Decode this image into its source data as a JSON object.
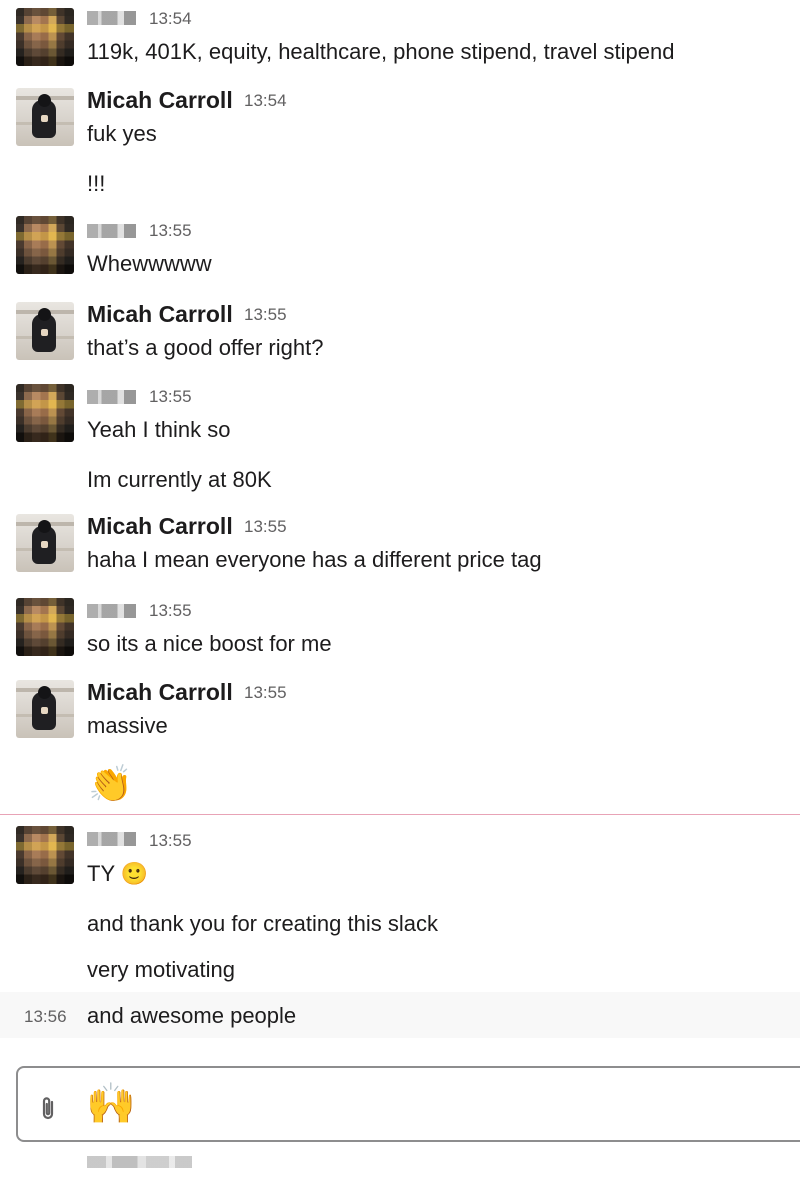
{
  "messages": [
    {
      "author": "",
      "time": "13:54",
      "lines": [
        "119k, 401K, equity, healthcare, phone stipend, travel stipend"
      ]
    },
    {
      "author": "Micah Carroll",
      "time": "13:54",
      "lines": [
        "fuk yes",
        "!!!"
      ]
    },
    {
      "author": "",
      "time": "13:55",
      "lines": [
        "Whewwwww"
      ]
    },
    {
      "author": "Micah Carroll",
      "time": "13:55",
      "lines": [
        "that’s a good offer right?"
      ]
    },
    {
      "author": "",
      "time": "13:55",
      "lines": [
        "Yeah I think so",
        "Im currently at 80K"
      ]
    },
    {
      "author": "Micah Carroll",
      "time": "13:55",
      "lines": [
        "haha I mean everyone has a different price tag"
      ]
    },
    {
      "author": "",
      "time": "13:55",
      "lines": [
        "so its a nice boost for me"
      ]
    },
    {
      "author": "Micah Carroll",
      "time": "13:55",
      "lines": [
        "massive",
        "👏"
      ]
    },
    {
      "author": "",
      "time": "13:55",
      "lines": [
        "TY 🙂",
        "and thank you for creating this slack",
        "very motivating",
        "and awesome people"
      ],
      "hover_time": "13:56"
    }
  ],
  "composer": {
    "value": "🙌",
    "attach_icon": "paperclip-icon"
  },
  "colors": {
    "new_divider": "#e8a3b6",
    "timestamp": "#616061",
    "text": "#1d1c1d"
  }
}
